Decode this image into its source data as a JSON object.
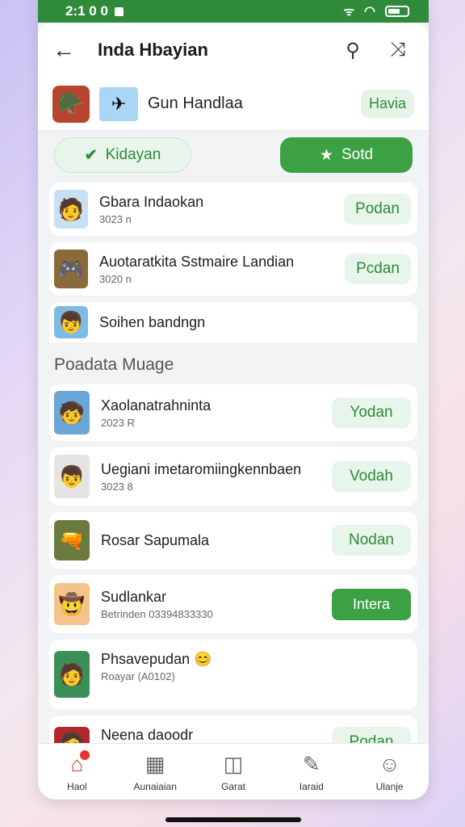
{
  "status": {
    "time": "2:1 0 0"
  },
  "header": {
    "title": "Inda Hbayian"
  },
  "featured": {
    "title": "Gun Handlaa",
    "action": "Havia"
  },
  "tabs": {
    "left": "Kidayan",
    "right": "Sotd"
  },
  "list_top": [
    {
      "name": "Gbara Indaokan",
      "sub": "3023 n",
      "action": "Podan",
      "icon": "🧑",
      "color": "#c9dff2"
    },
    {
      "name": "Auotaratkita Sstmaire Landian",
      "sub": "3020 n",
      "action": "Pcdan",
      "icon": "🎮",
      "color": "#8a6a3a"
    },
    {
      "name": "Soihen bandngn",
      "sub": "",
      "action": "",
      "icon": "👦",
      "color": "#7dbbe6"
    }
  ],
  "section": {
    "title": "Poadata Muage"
  },
  "list_bottom": [
    {
      "name": "Xaolanatrahninta",
      "sub": "2023 R",
      "action": "Yodan",
      "icon": "🧒",
      "color": "#6aa6d8",
      "style": "light"
    },
    {
      "name": "Uegiani imetaromiingkennbaen",
      "sub": "3023 8",
      "action": "Vodah",
      "icon": "👦",
      "color": "#e4e4e4",
      "style": "light"
    },
    {
      "name": "Rosar Sapumala",
      "sub": "",
      "action": "Nodan",
      "icon": "🔫",
      "color": "#6b7a3f",
      "style": "light"
    },
    {
      "name": "Sudlankar",
      "sub": "Betrinden 03394833330",
      "action": "Intera",
      "icon": "🤠",
      "color": "#f2c489",
      "style": "dark"
    },
    {
      "name": "Phsavepudan 😊",
      "sub": "Roayar (A0102)",
      "action": "",
      "icon": "🧑",
      "color": "#3d8f5a",
      "style": "none"
    },
    {
      "name": "Neena daoodr",
      "sub": "",
      "action": "Podan",
      "icon": "🧑",
      "color": "#b3262a",
      "style": "light"
    }
  ],
  "nav": [
    {
      "label": "Haol",
      "icon": "⌂"
    },
    {
      "label": "Aunaiaian",
      "icon": "▦"
    },
    {
      "label": "Garat",
      "icon": "◫"
    },
    {
      "label": "Iaraid",
      "icon": "✎"
    },
    {
      "label": "Ulanje",
      "icon": "☺"
    }
  ]
}
